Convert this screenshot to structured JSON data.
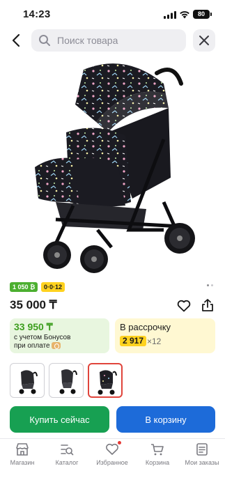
{
  "status_bar": {
    "time": "14:23",
    "battery": "80"
  },
  "search": {
    "placeholder": "Поиск товара"
  },
  "badges": {
    "bonus": "1 050 ₿",
    "installment": "0·0·12"
  },
  "product": {
    "price": "35 000 ₸"
  },
  "bonus_card": {
    "price": "33 950 ₸",
    "note_line1": "с учетом Бонусов",
    "note_line2": "при оплате"
  },
  "installment_card": {
    "title": "В рассрочку",
    "amount": "2 917",
    "multiplier": "×12"
  },
  "gallery": {
    "total_images": 3,
    "selected_index": 2
  },
  "actions": {
    "buy_now": "Купить сейчас",
    "add_to_cart": "В корзину"
  },
  "tab_bar": {
    "items": [
      {
        "label": "Магазин",
        "icon": "store-icon"
      },
      {
        "label": "Каталог",
        "icon": "catalog-icon"
      },
      {
        "label": "Избранное",
        "icon": "heart-icon",
        "has_notification": true
      },
      {
        "label": "Корзина",
        "icon": "cart-icon"
      },
      {
        "label": "Мои заказы",
        "icon": "orders-icon"
      }
    ]
  },
  "colors": {
    "green_button": "#17a052",
    "blue_button": "#1d6bd9",
    "selected_border": "#e0443b",
    "bonus_green": "#3d9e1f",
    "installment_yellow": "#ffd21f"
  }
}
